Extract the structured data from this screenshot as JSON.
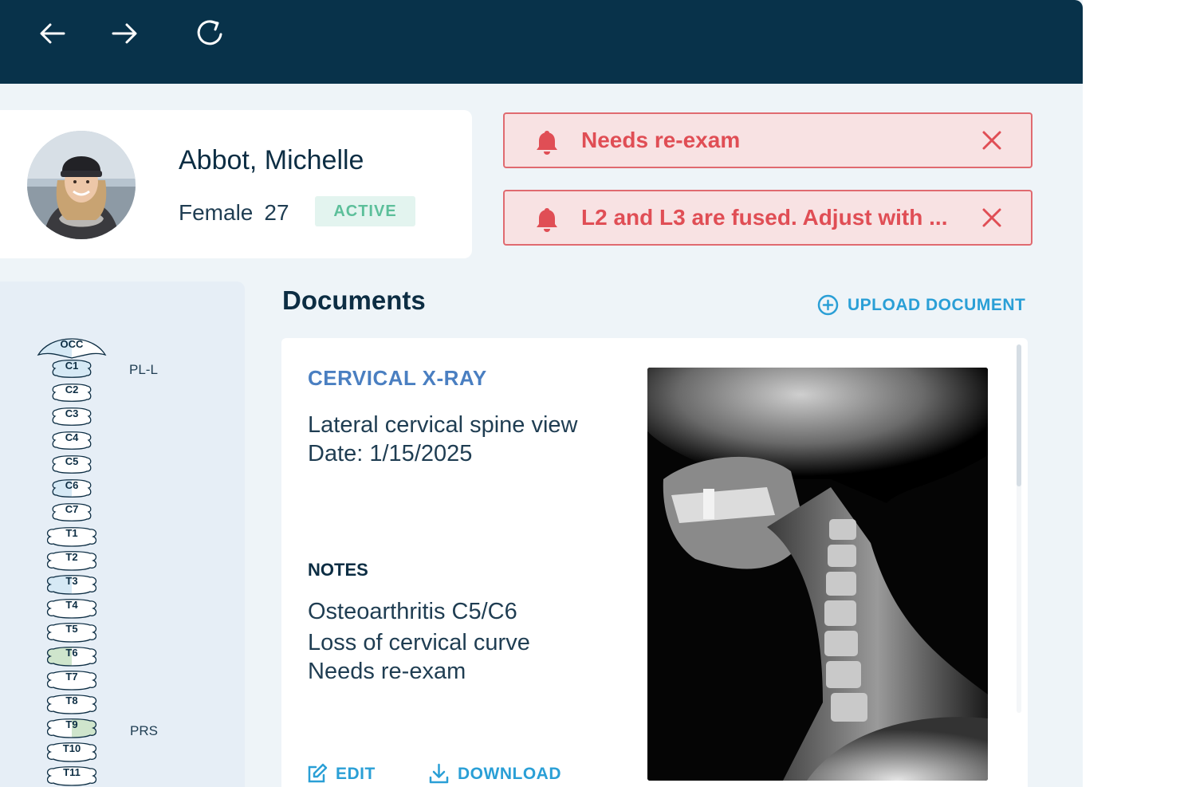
{
  "nav": {
    "back_icon": "arrow-left-icon",
    "forward_icon": "arrow-right-icon",
    "reload_icon": "refresh-icon"
  },
  "patient": {
    "name": "Abbot, Michelle",
    "sex": "Female",
    "age": "27",
    "status": "ACTIVE"
  },
  "alerts": [
    {
      "text": "Needs re-exam",
      "icon": "bell-icon"
    },
    {
      "text": "L2 and L3 are fused. Adjust with ...",
      "icon": "bell-icon"
    }
  ],
  "spine": {
    "vertebrae": [
      "OCC",
      "C1",
      "C2",
      "C3",
      "C4",
      "C5",
      "C6",
      "C7",
      "T1",
      "T2",
      "T3",
      "T4",
      "T5",
      "T6",
      "T7",
      "T8",
      "T9",
      "T10",
      "T11"
    ],
    "side_labels": {
      "c1": "PL-L",
      "t9": "PRS"
    }
  },
  "documents": {
    "title": "Documents",
    "upload_label": "UPLOAD DOCUMENT",
    "card": {
      "type": "CERVICAL X-RAY",
      "description": "Lateral cervical spine view",
      "date": "Date: 1/15/2025",
      "notes_heading": "NOTES",
      "notes": [
        "Osteoarthritis C5/C6",
        "Loss of cervical curve",
        "Needs re-exam"
      ],
      "edit_label": "EDIT",
      "download_label": "DOWNLOAD"
    }
  },
  "colors": {
    "topbar": "#08324a",
    "alert_bg": "#f8e2e3",
    "alert_text": "#e04e55",
    "accent": "#2a9fd6",
    "status": "#5cbf9a"
  }
}
